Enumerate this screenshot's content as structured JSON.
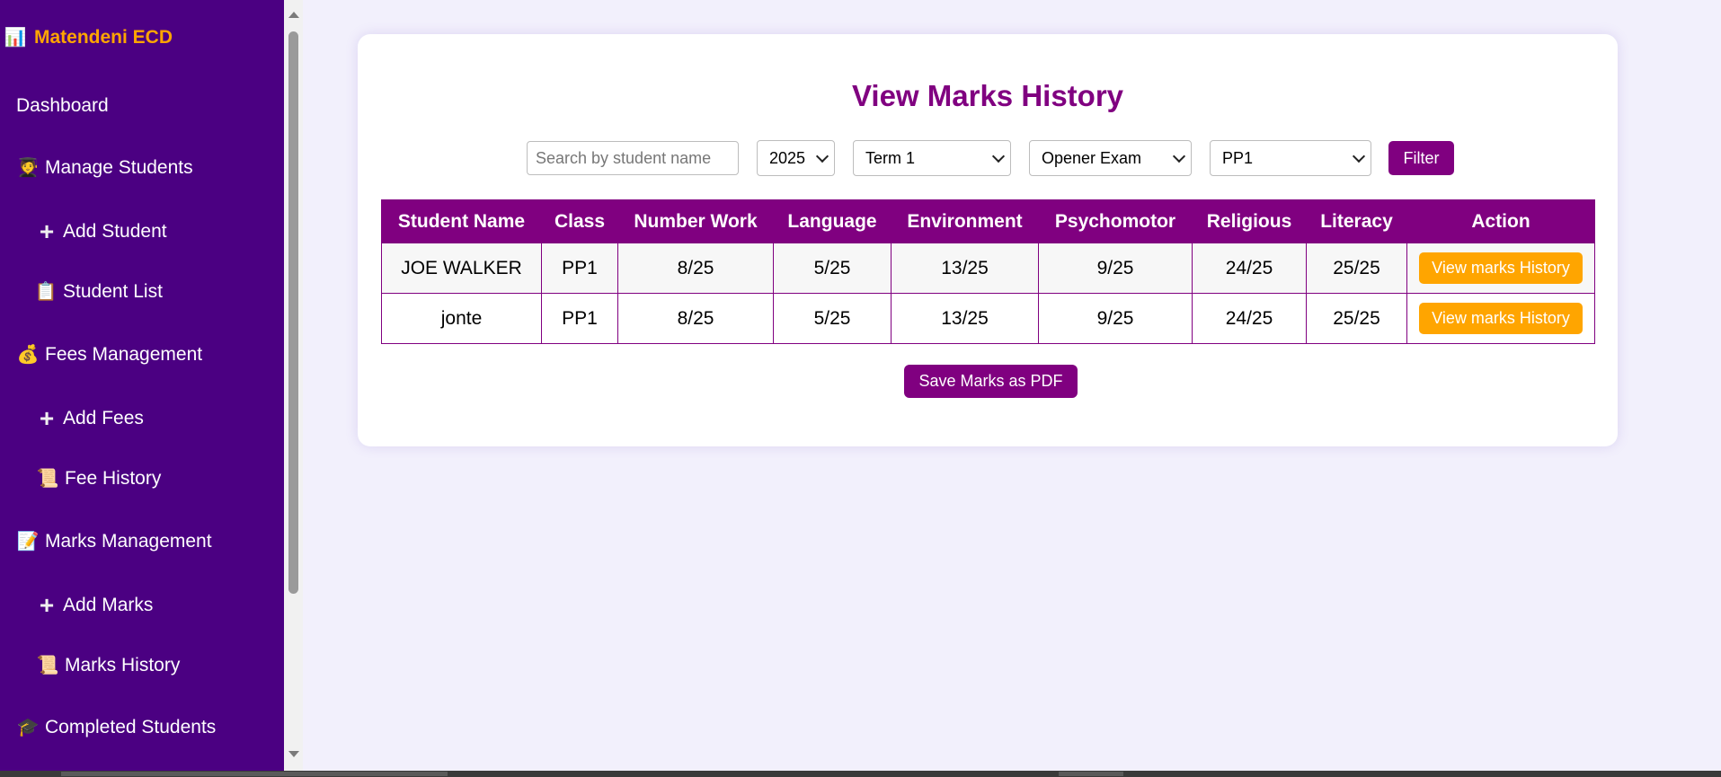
{
  "sidebar": {
    "brand": {
      "icon": "bar-chart-icon",
      "glyph": "📊",
      "label": "Matendeni ECD"
    },
    "items": [
      {
        "label": "Dashboard",
        "icon": "",
        "glyph": ""
      },
      {
        "label": "Manage Students",
        "icon": "student-icon",
        "glyph": "🧑‍🎓"
      },
      {
        "label": "Add Student",
        "icon": "plus-icon",
        "glyph": "+"
      },
      {
        "label": "Student List",
        "icon": "clipboard-icon",
        "glyph": "📋"
      },
      {
        "label": "Fees Management",
        "icon": "money-bag-icon",
        "glyph": "💰"
      },
      {
        "label": "Add Fees",
        "icon": "plus-icon",
        "glyph": "+"
      },
      {
        "label": "Fee History",
        "icon": "scroll-icon",
        "glyph": "📜"
      },
      {
        "label": "Marks Management",
        "icon": "memo-icon",
        "glyph": "📝"
      },
      {
        "label": "Add Marks",
        "icon": "plus-icon",
        "glyph": "+"
      },
      {
        "label": "Marks History",
        "icon": "scroll-icon",
        "glyph": "📜"
      },
      {
        "label": "Completed Students",
        "icon": "graduation-cap-icon",
        "glyph": "🎓"
      }
    ]
  },
  "main": {
    "title": "View Marks History",
    "filters": {
      "search_placeholder": "Search by student name",
      "search_value": "",
      "year": "2025",
      "term": "Term 1",
      "exam": "Opener Exam",
      "class": "PP1",
      "filter_label": "Filter"
    },
    "table": {
      "headers": [
        "Student Name",
        "Class",
        "Number Work",
        "Language",
        "Environment",
        "Psychomotor",
        "Religious",
        "Literacy",
        "Action"
      ],
      "rows": [
        {
          "name": "JOE WALKER",
          "class": "PP1",
          "number_work": "8/25",
          "language": "5/25",
          "environment": "13/25",
          "psychomotor": "9/25",
          "religious": "24/25",
          "literacy": "25/25",
          "action": "View marks History"
        },
        {
          "name": "jonte",
          "class": "PP1",
          "number_work": "8/25",
          "language": "5/25",
          "environment": "13/25",
          "psychomotor": "9/25",
          "religious": "24/25",
          "literacy": "25/25",
          "action": "View marks History"
        }
      ]
    },
    "save_pdf_label": "Save Marks as PDF"
  },
  "colors": {
    "sidebar_bg": "#4b0082",
    "accent_purple": "#800080",
    "accent_orange": "#ffa500",
    "page_bg": "#f2f0fc"
  }
}
